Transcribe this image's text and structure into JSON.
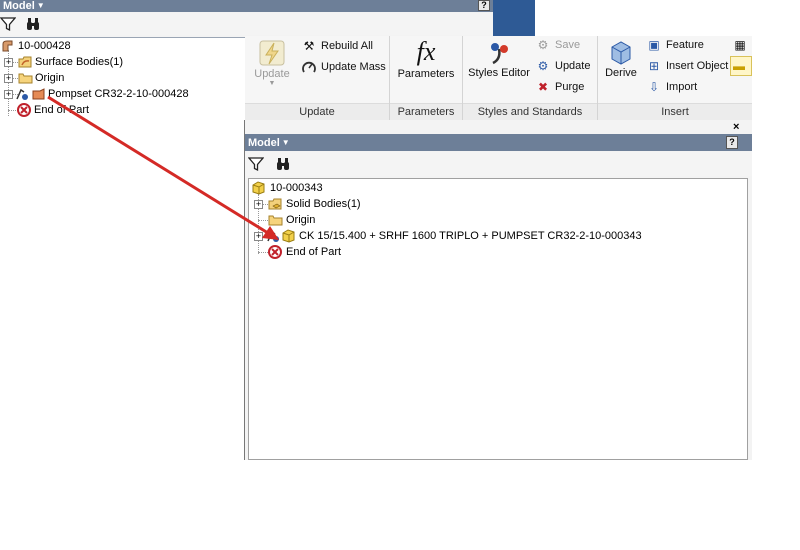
{
  "left_panel": {
    "title": "Model",
    "help": "?",
    "filter_icon": "filter-icon",
    "find_icon": "binoculars-icon",
    "tree": {
      "root": "10-000428",
      "items": [
        "Surface Bodies(1)",
        "Origin",
        "Pompset CR32-2-10-000428",
        "End of Part"
      ]
    }
  },
  "ribbon": {
    "update_group": {
      "update_label": "Update",
      "rebuild_all": "Rebuild All",
      "update_mass": "Update Mass",
      "group_label": "Update"
    },
    "parameters_group": {
      "fx": "fx",
      "parameters_label": "Parameters",
      "group_label": "Parameters"
    },
    "styles_group": {
      "styles_editor": "Styles Editor",
      "save": "Save",
      "update": "Update",
      "purge": "Purge",
      "group_label": "Styles and Standards"
    },
    "insert_group": {
      "derive": "Derive",
      "feature": "Feature",
      "insert_object": "Insert Object",
      "import": "Import",
      "group_label": "Insert"
    }
  },
  "right_panel": {
    "title": "Model",
    "help": "?",
    "close": "×",
    "filter_icon": "filter-icon",
    "find_icon": "binoculars-icon",
    "tree": {
      "root": "10-000343",
      "items": [
        "Solid Bodies(1)",
        "Origin",
        "CK 15/15.400 + SRHF 1600 TRIPLO + PUMPSET CR32-2-10-000343",
        "End of Part"
      ]
    }
  },
  "colors": {
    "titlebar": "#6d7f98",
    "blue_band": "#2e5a95",
    "arrow": "#d42a26"
  }
}
